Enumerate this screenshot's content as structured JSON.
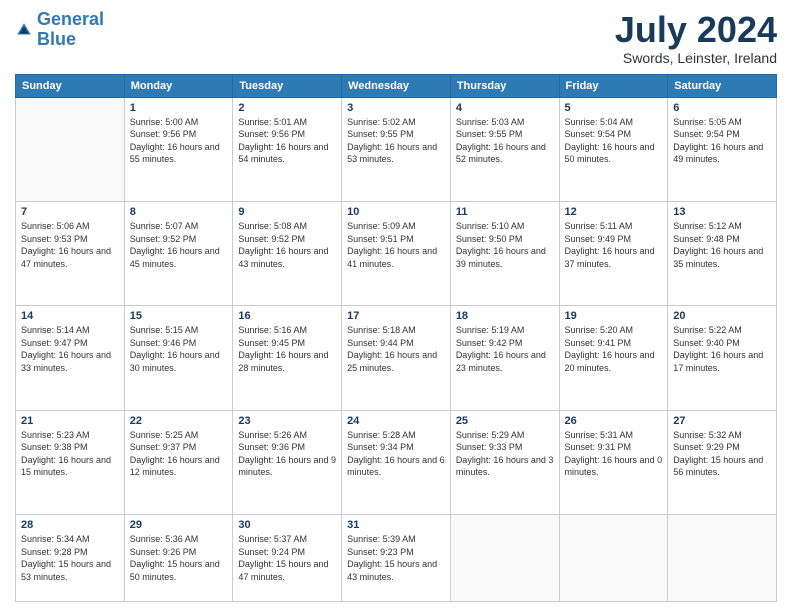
{
  "header": {
    "logo_line1": "General",
    "logo_line2": "Blue",
    "title": "July 2024",
    "location": "Swords, Leinster, Ireland"
  },
  "weekdays": [
    "Sunday",
    "Monday",
    "Tuesday",
    "Wednesday",
    "Thursday",
    "Friday",
    "Saturday"
  ],
  "weeks": [
    [
      {
        "day": "",
        "sunrise": "",
        "sunset": "",
        "daylight": ""
      },
      {
        "day": "1",
        "sunrise": "5:00 AM",
        "sunset": "9:56 PM",
        "daylight": "16 hours and 55 minutes."
      },
      {
        "day": "2",
        "sunrise": "5:01 AM",
        "sunset": "9:56 PM",
        "daylight": "16 hours and 54 minutes."
      },
      {
        "day": "3",
        "sunrise": "5:02 AM",
        "sunset": "9:55 PM",
        "daylight": "16 hours and 53 minutes."
      },
      {
        "day": "4",
        "sunrise": "5:03 AM",
        "sunset": "9:55 PM",
        "daylight": "16 hours and 52 minutes."
      },
      {
        "day": "5",
        "sunrise": "5:04 AM",
        "sunset": "9:54 PM",
        "daylight": "16 hours and 50 minutes."
      },
      {
        "day": "6",
        "sunrise": "5:05 AM",
        "sunset": "9:54 PM",
        "daylight": "16 hours and 49 minutes."
      }
    ],
    [
      {
        "day": "7",
        "sunrise": "5:06 AM",
        "sunset": "9:53 PM",
        "daylight": "16 hours and 47 minutes."
      },
      {
        "day": "8",
        "sunrise": "5:07 AM",
        "sunset": "9:52 PM",
        "daylight": "16 hours and 45 minutes."
      },
      {
        "day": "9",
        "sunrise": "5:08 AM",
        "sunset": "9:52 PM",
        "daylight": "16 hours and 43 minutes."
      },
      {
        "day": "10",
        "sunrise": "5:09 AM",
        "sunset": "9:51 PM",
        "daylight": "16 hours and 41 minutes."
      },
      {
        "day": "11",
        "sunrise": "5:10 AM",
        "sunset": "9:50 PM",
        "daylight": "16 hours and 39 minutes."
      },
      {
        "day": "12",
        "sunrise": "5:11 AM",
        "sunset": "9:49 PM",
        "daylight": "16 hours and 37 minutes."
      },
      {
        "day": "13",
        "sunrise": "5:12 AM",
        "sunset": "9:48 PM",
        "daylight": "16 hours and 35 minutes."
      }
    ],
    [
      {
        "day": "14",
        "sunrise": "5:14 AM",
        "sunset": "9:47 PM",
        "daylight": "16 hours and 33 minutes."
      },
      {
        "day": "15",
        "sunrise": "5:15 AM",
        "sunset": "9:46 PM",
        "daylight": "16 hours and 30 minutes."
      },
      {
        "day": "16",
        "sunrise": "5:16 AM",
        "sunset": "9:45 PM",
        "daylight": "16 hours and 28 minutes."
      },
      {
        "day": "17",
        "sunrise": "5:18 AM",
        "sunset": "9:44 PM",
        "daylight": "16 hours and 25 minutes."
      },
      {
        "day": "18",
        "sunrise": "5:19 AM",
        "sunset": "9:42 PM",
        "daylight": "16 hours and 23 minutes."
      },
      {
        "day": "19",
        "sunrise": "5:20 AM",
        "sunset": "9:41 PM",
        "daylight": "16 hours and 20 minutes."
      },
      {
        "day": "20",
        "sunrise": "5:22 AM",
        "sunset": "9:40 PM",
        "daylight": "16 hours and 17 minutes."
      }
    ],
    [
      {
        "day": "21",
        "sunrise": "5:23 AM",
        "sunset": "9:38 PM",
        "daylight": "16 hours and 15 minutes."
      },
      {
        "day": "22",
        "sunrise": "5:25 AM",
        "sunset": "9:37 PM",
        "daylight": "16 hours and 12 minutes."
      },
      {
        "day": "23",
        "sunrise": "5:26 AM",
        "sunset": "9:36 PM",
        "daylight": "16 hours and 9 minutes."
      },
      {
        "day": "24",
        "sunrise": "5:28 AM",
        "sunset": "9:34 PM",
        "daylight": "16 hours and 6 minutes."
      },
      {
        "day": "25",
        "sunrise": "5:29 AM",
        "sunset": "9:33 PM",
        "daylight": "16 hours and 3 minutes."
      },
      {
        "day": "26",
        "sunrise": "5:31 AM",
        "sunset": "9:31 PM",
        "daylight": "16 hours and 0 minutes."
      },
      {
        "day": "27",
        "sunrise": "5:32 AM",
        "sunset": "9:29 PM",
        "daylight": "15 hours and 56 minutes."
      }
    ],
    [
      {
        "day": "28",
        "sunrise": "5:34 AM",
        "sunset": "9:28 PM",
        "daylight": "15 hours and 53 minutes."
      },
      {
        "day": "29",
        "sunrise": "5:36 AM",
        "sunset": "9:26 PM",
        "daylight": "15 hours and 50 minutes."
      },
      {
        "day": "30",
        "sunrise": "5:37 AM",
        "sunset": "9:24 PM",
        "daylight": "15 hours and 47 minutes."
      },
      {
        "day": "31",
        "sunrise": "5:39 AM",
        "sunset": "9:23 PM",
        "daylight": "15 hours and 43 minutes."
      },
      {
        "day": "",
        "sunrise": "",
        "sunset": "",
        "daylight": ""
      },
      {
        "day": "",
        "sunrise": "",
        "sunset": "",
        "daylight": ""
      },
      {
        "day": "",
        "sunrise": "",
        "sunset": "",
        "daylight": ""
      }
    ]
  ]
}
